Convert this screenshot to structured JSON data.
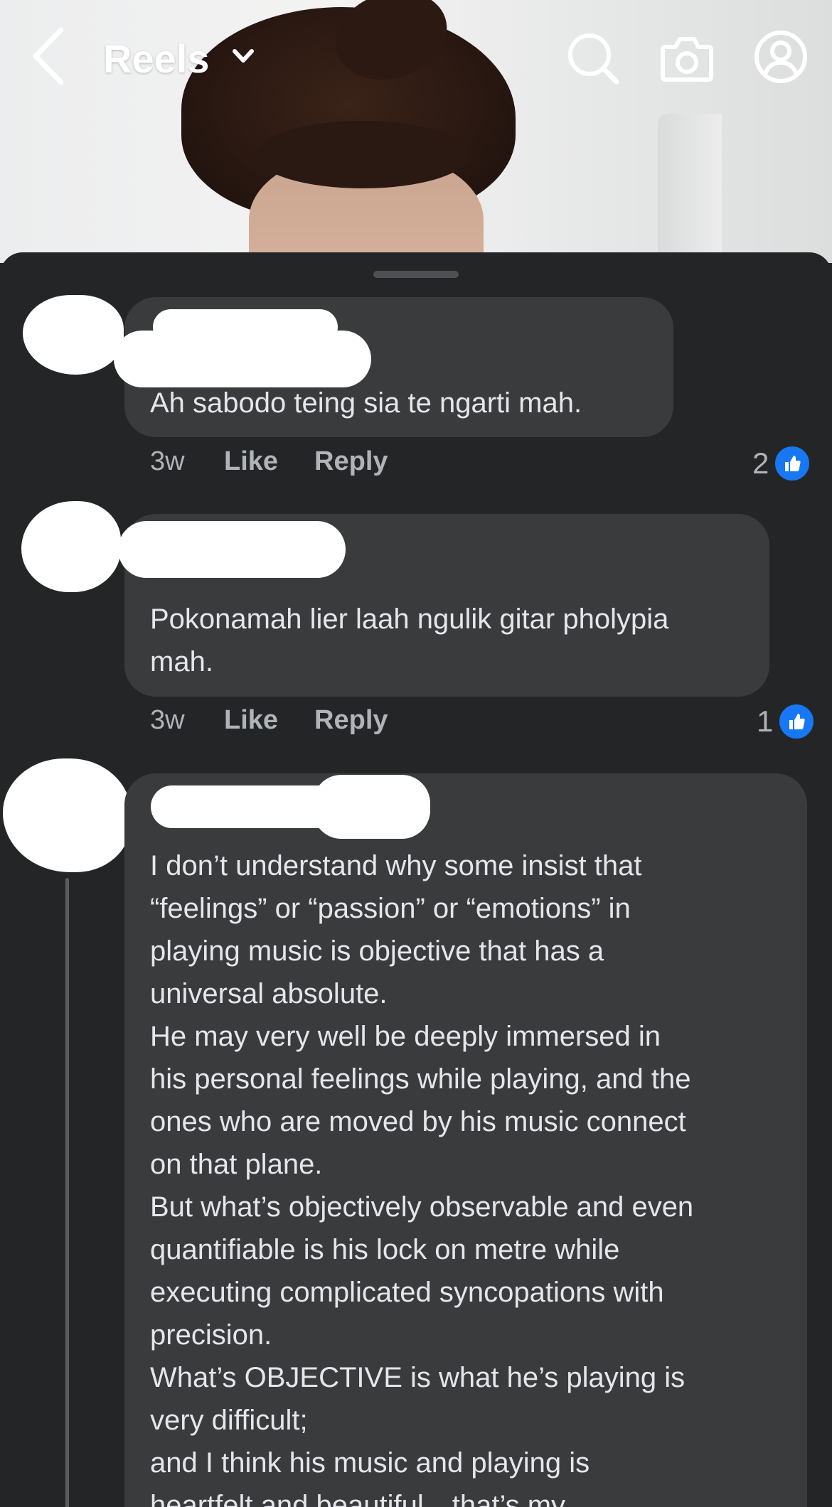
{
  "header": {
    "title": "Reels",
    "icons": [
      "back-icon",
      "chevron-down-icon",
      "search-icon",
      "camera-icon",
      "profile-icon"
    ]
  },
  "comments": [
    {
      "text": "Ah sabodo teing sia te ngarti mah.",
      "time": "3w",
      "like_label": "Like",
      "reply_label": "Reply",
      "reaction_count": "2"
    },
    {
      "text": "Pokonamah lier laah ngulik gitar pholypia\nmah.",
      "time": "3w",
      "like_label": "Like",
      "reply_label": "Reply",
      "reaction_count": "1"
    },
    {
      "text": "I don’t understand why some insist that\n“feelings” or “passion” or “emotions” in\nplaying music is objective that has a\nuniversal absolute.\nHe may very well be deeply immersed in\nhis personal feelings while playing, and the\nones who are moved by his music connect\non that plane.\nBut what’s objectively observable and even\nquantifiable is his lock on metre while\nexecuting complicated syncopations with\nprecision.\nWhat’s OBJECTIVE is what he’s playing is\nvery difficult;\nand I think his music and playing is\nheartfelt and beautiful…that’s my"
    }
  ],
  "colors": {
    "sheet_bg": "#242527",
    "bubble_bg": "#3a3b3c",
    "text": "#e4e6eb",
    "meta_text": "#b0b3b8",
    "like_blue": "#1877f2"
  }
}
